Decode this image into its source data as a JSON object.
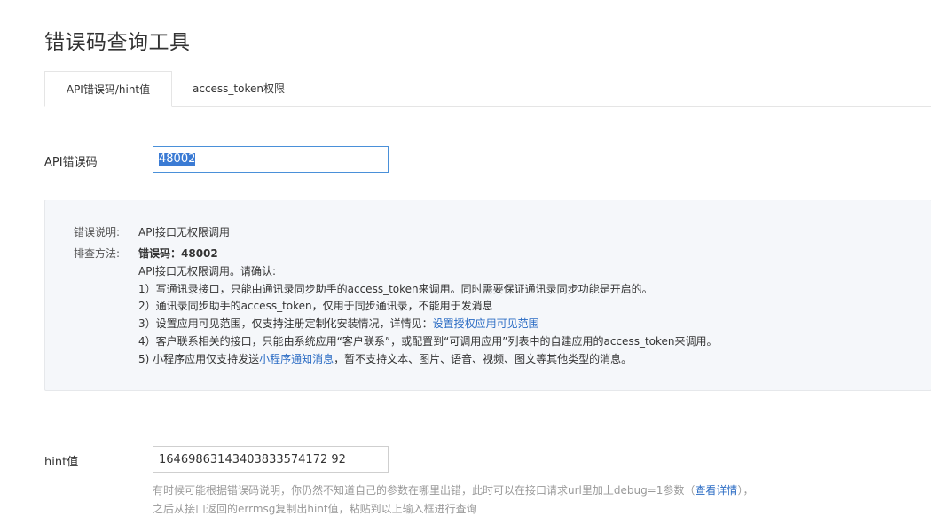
{
  "page": {
    "title": "错误码查询工具"
  },
  "tabs": [
    {
      "label": "API错误码/hint值"
    },
    {
      "label": "access_token权限"
    }
  ],
  "api_code": {
    "label": "API错误码",
    "value": "48002"
  },
  "result": {
    "desc_label": "错误说明:",
    "desc_value": "API接口无权限调用",
    "troubleshoot_label": "排查方法:",
    "code_line": "错误码：48002",
    "intro": "API接口无权限调用。请确认:",
    "step1": "1）写通讯录接口，只能由通讯录同步助手的access_token来调用。同时需要保证通讯录同步功能是开启的。",
    "step2": "2）通讯录同步助手的access_token，仅用于同步通讯录，不能用于发消息",
    "step3_prefix": "3）设置应用可见范围，仅支持注册定制化安装情况，详情见：",
    "step3_link": "设置授权应用可见范围",
    "step4": "4）客户联系相关的接口，只能由系统应用“客户联系”，或配置到“可调用应用”列表中的自建应用的access_token来调用。",
    "step5_prefix": "5) 小程序应用仅支持发送",
    "step5_link": "小程序通知消息",
    "step5_suffix": "，暂不支持文本、图片、语音、视频、图文等其他类型的消息。"
  },
  "hint": {
    "label": "hint值",
    "value": "16469863143403833574172 92",
    "note_line1_prefix": "有时候可能根据错误码说明，你仍然不知道自己的参数在哪里出错，此时可以在接口请求url里加上debug=1参数（",
    "note_link": "查看详情",
    "note_line1_suffix": "），",
    "note_line2": "之后从接口返回的errmsg复制出hint值，粘贴到以上输入框进行查询"
  }
}
